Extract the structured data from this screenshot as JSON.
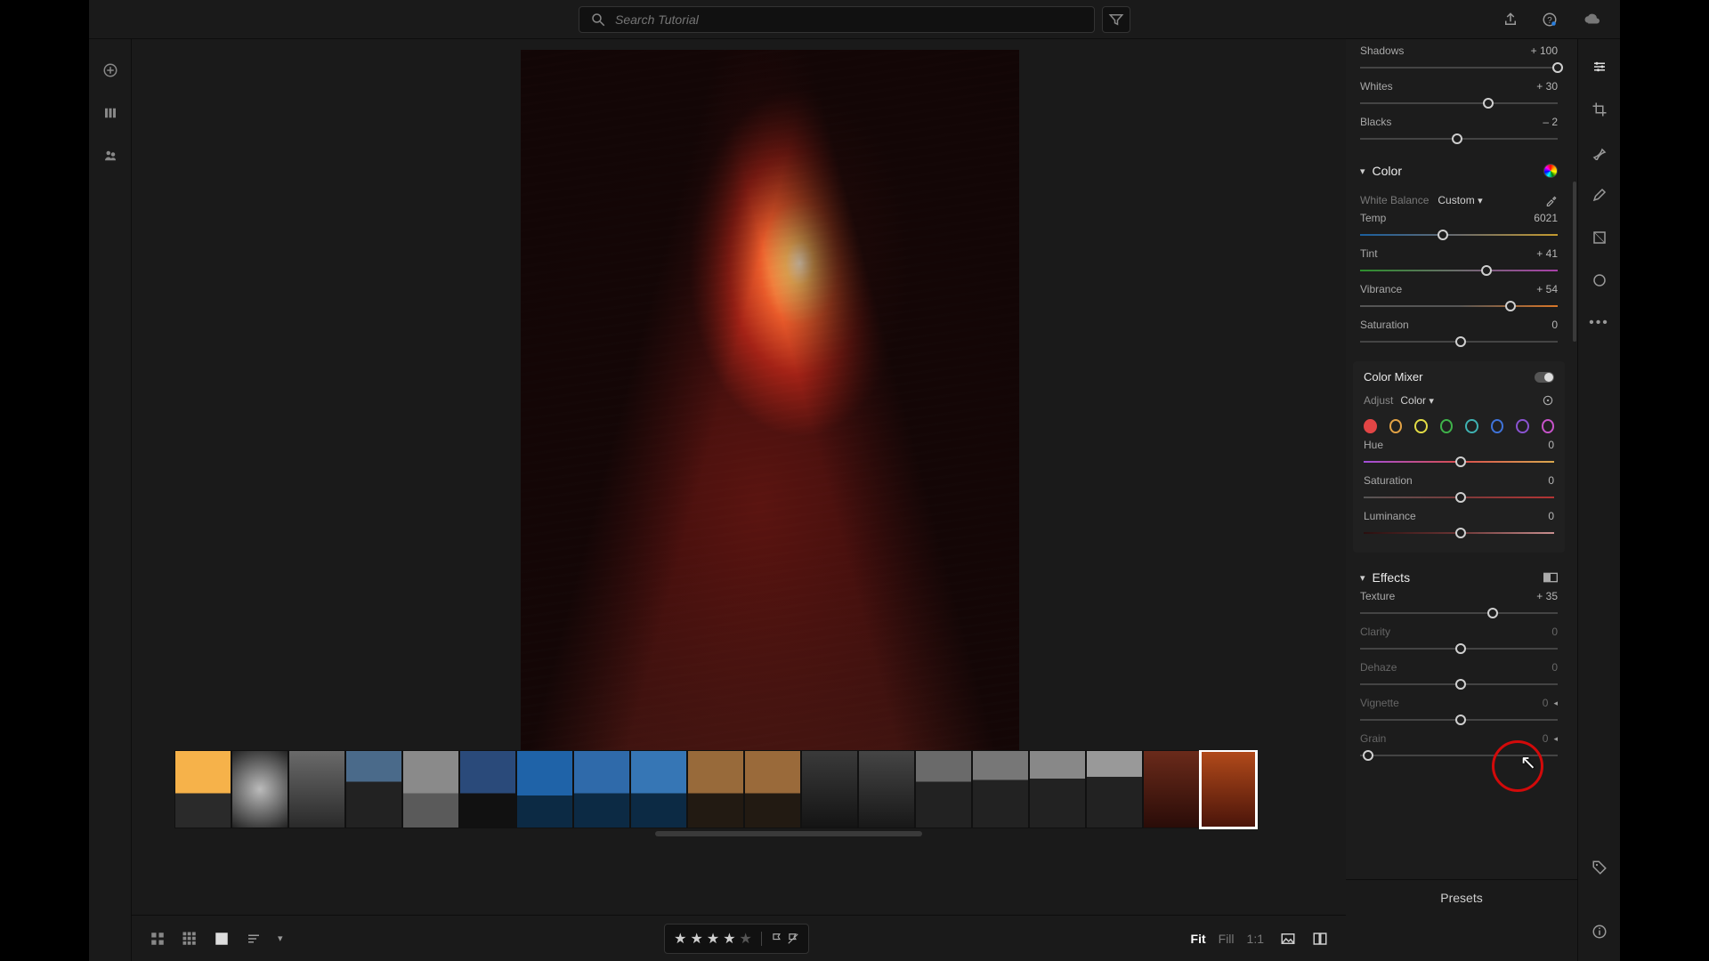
{
  "search": {
    "placeholder": "Search Tutorial"
  },
  "panel": {
    "shadows": {
      "label": "Shadows",
      "value": "+ 100",
      "pct": 100
    },
    "whites": {
      "label": "Whites",
      "value": "+ 30",
      "pct": 65
    },
    "blacks": {
      "label": "Blacks",
      "value": "– 2",
      "pct": 49
    },
    "color_section": "Color",
    "wb_label": "White Balance",
    "wb_value": "Custom",
    "temp": {
      "label": "Temp",
      "value": "6021",
      "pct": 42
    },
    "tint": {
      "label": "Tint",
      "value": "+ 41",
      "pct": 64
    },
    "vibrance": {
      "label": "Vibrance",
      "value": "+ 54",
      "pct": 76
    },
    "saturation": {
      "label": "Saturation",
      "value": "0",
      "pct": 51
    },
    "mixer_title": "Color Mixer",
    "mixer_adjust_label": "Adjust",
    "mixer_adjust_value": "Color",
    "mixer_colors": [
      "#e24545",
      "#e2a245",
      "#e2dc45",
      "#3fb24a",
      "#3fb2b2",
      "#3f73d9",
      "#8a53d1",
      "#c653c9"
    ],
    "hue": {
      "label": "Hue",
      "value": "0",
      "pct": 51
    },
    "mix_sat": {
      "label": "Saturation",
      "value": "0",
      "pct": 51
    },
    "luminance": {
      "label": "Luminance",
      "value": "0",
      "pct": 51
    },
    "effects_section": "Effects",
    "texture": {
      "label": "Texture",
      "value": "+ 35",
      "pct": 67
    },
    "clarity": {
      "label": "Clarity",
      "value": "0",
      "pct": 51
    },
    "dehaze": {
      "label": "Dehaze",
      "value": "0",
      "pct": 51
    },
    "vignette": {
      "label": "Vignette",
      "value": "0",
      "pct": 51
    },
    "grain": {
      "label": "Grain",
      "value": "0",
      "pct": 4
    },
    "presets": "Presets"
  },
  "bottom": {
    "zoom": {
      "fit": "Fit",
      "fill": "Fill",
      "one": "1:1"
    },
    "stars_filled": 4
  },
  "filmstrip": {
    "thumbs": [
      {
        "bg": "linear-gradient(#f6b24a 0 55%,#2a2a2a 55%)"
      },
      {
        "bg": "radial-gradient(circle at 50% 50%,#bbb,#222)"
      },
      {
        "bg": "linear-gradient(#6a6a6a,#2a2a2a)"
      },
      {
        "bg": "linear-gradient(#4a6a8a 0 40%,#222 40%)"
      },
      {
        "bg": "linear-gradient(#8a8a8a 0 55%,#5a5a5a 55%)"
      },
      {
        "bg": "linear-gradient(#2a4a7a 0 55%,#111 55%)"
      },
      {
        "bg": "linear-gradient(#1f63a8 0 58%,#0c2a44 58%)"
      },
      {
        "bg": "linear-gradient(#2f6aaa 0 55%,#0c2a44 55%)"
      },
      {
        "bg": "linear-gradient(#3676b5 0 55%,#0c2a44 55%)"
      },
      {
        "bg": "linear-gradient(#986a3a 0 55%,#221a12 55%)"
      },
      {
        "bg": "linear-gradient(#9a6a3a 0 55%,#221a12 55%)"
      },
      {
        "bg": "linear-gradient(#3a3a3a,#141414)"
      },
      {
        "bg": "linear-gradient(#454545,#181818)"
      },
      {
        "bg": "linear-gradient(#6a6a6a 0 40%,#222 40%)"
      },
      {
        "bg": "linear-gradient(#777 0 38%,#222 38%)"
      },
      {
        "bg": "linear-gradient(#888 0 36%,#222 36%)"
      },
      {
        "bg": "linear-gradient(#999 0 34%,#222 34%)"
      },
      {
        "bg": "linear-gradient(#6a2a1a,#2a0c08)"
      },
      {
        "bg": "linear-gradient(#b24a1a,#4a140a)",
        "sel": true
      }
    ]
  }
}
